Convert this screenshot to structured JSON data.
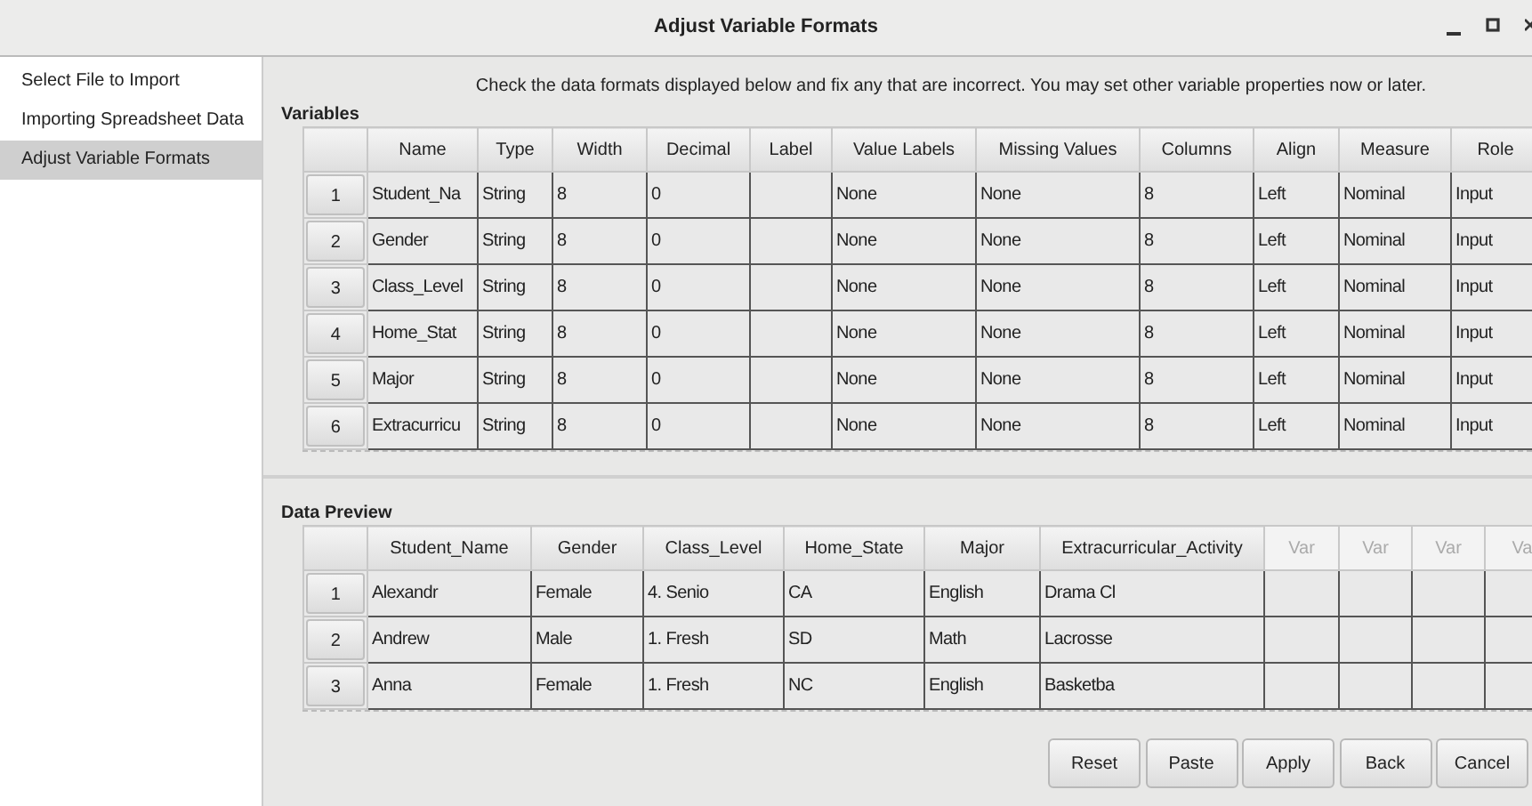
{
  "window": {
    "title": "Adjust Variable Formats"
  },
  "sidebar": {
    "items": [
      {
        "label": "Select File to Import",
        "selected": false
      },
      {
        "label": "Importing Spreadsheet Data",
        "selected": false
      },
      {
        "label": "Adjust Variable Formats",
        "selected": true
      }
    ]
  },
  "instructions": "Check the data formats displayed below and fix any that are incorrect.  You may set other variable properties now or later.",
  "variables": {
    "title": "Variables",
    "columns": [
      {
        "label": "Name",
        "disabled": false
      },
      {
        "label": "Type",
        "disabled": false
      },
      {
        "label": "Width",
        "disabled": false
      },
      {
        "label": "Decimal",
        "disabled": false
      },
      {
        "label": "Label",
        "disabled": false
      },
      {
        "label": "Value Labels",
        "disabled": false
      },
      {
        "label": "Missing Values",
        "disabled": false
      },
      {
        "label": "Columns",
        "disabled": false
      },
      {
        "label": "Align",
        "disabled": false
      },
      {
        "label": "Measure",
        "disabled": false
      },
      {
        "label": "Role",
        "disabled": false
      }
    ],
    "rows": [
      {
        "number": "1",
        "cells": [
          "Student_Na",
          "String",
          "8",
          "0",
          "",
          "None",
          "None",
          "8",
          "Left",
          "Nominal",
          "Input"
        ]
      },
      {
        "number": "2",
        "cells": [
          "Gender",
          "String",
          "8",
          "0",
          "",
          "None",
          "None",
          "8",
          "Left",
          "Nominal",
          "Input"
        ]
      },
      {
        "number": "3",
        "cells": [
          "Class_Level",
          "String",
          "8",
          "0",
          "",
          "None",
          "None",
          "8",
          "Left",
          "Nominal",
          "Input"
        ]
      },
      {
        "number": "4",
        "cells": [
          "Home_Stat",
          "String",
          "8",
          "0",
          "",
          "None",
          "None",
          "8",
          "Left",
          "Nominal",
          "Input"
        ]
      },
      {
        "number": "5",
        "cells": [
          "Major",
          "String",
          "8",
          "0",
          "",
          "None",
          "None",
          "8",
          "Left",
          "Nominal",
          "Input"
        ]
      },
      {
        "number": "6",
        "cells": [
          "Extracurricu",
          "String",
          "8",
          "0",
          "",
          "None",
          "None",
          "8",
          "Left",
          "Nominal",
          "Input"
        ]
      }
    ]
  },
  "data_preview": {
    "title": "Data Preview",
    "columns": [
      {
        "label": "Student_Name",
        "disabled": false
      },
      {
        "label": "Gender",
        "disabled": false
      },
      {
        "label": "Class_Level",
        "disabled": false
      },
      {
        "label": "Home_State",
        "disabled": false
      },
      {
        "label": "Major",
        "disabled": false
      },
      {
        "label": "Extracurricular_Activity",
        "disabled": false
      },
      {
        "label": "Var",
        "disabled": true
      },
      {
        "label": "Var",
        "disabled": true
      },
      {
        "label": "Var",
        "disabled": true
      },
      {
        "label": "Va",
        "disabled": true
      }
    ],
    "rows": [
      {
        "number": "1",
        "cells": [
          "Alexandr",
          "Female",
          "4. Senio",
          "CA",
          "English",
          "Drama Cl",
          "",
          "",
          "",
          ""
        ]
      },
      {
        "number": "2",
        "cells": [
          "Andrew",
          "Male",
          "1. Fresh",
          "SD",
          "Math",
          "Lacrosse",
          "",
          "",
          "",
          ""
        ]
      },
      {
        "number": "3",
        "cells": [
          "Anna",
          "Female",
          "1. Fresh",
          "NC",
          "English",
          "Basketba",
          "",
          "",
          "",
          ""
        ]
      }
    ]
  },
  "buttons": [
    "Reset",
    "Paste",
    "Apply",
    "Back",
    "Cancel"
  ]
}
